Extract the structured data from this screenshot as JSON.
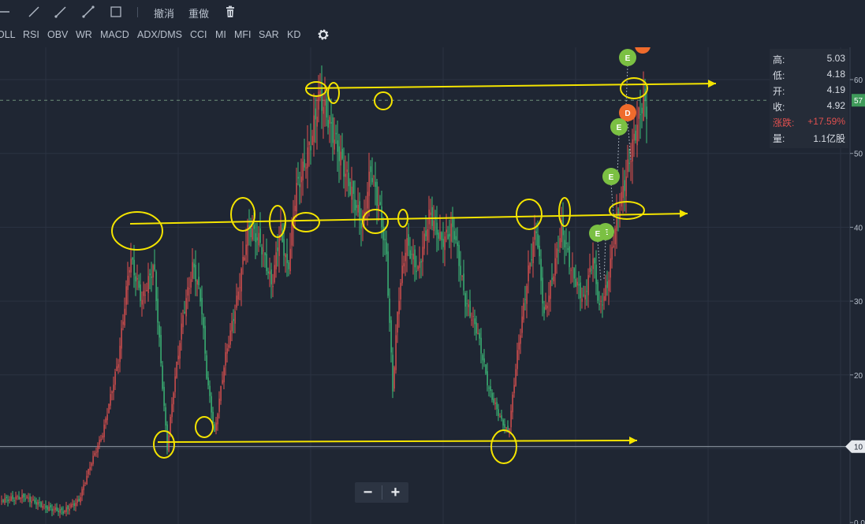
{
  "toolbar": {
    "undo_label": "撤消",
    "redo_label": "重做"
  },
  "indicators": [
    "OLL",
    "RSI",
    "OBV",
    "WR",
    "MACD",
    "ADX/DMS",
    "CCI",
    "MI",
    "MFI",
    "SAR",
    "KD"
  ],
  "info_panel": {
    "high_label": "高:",
    "high_value": "5.03",
    "low_label": "低:",
    "low_value": "4.18",
    "open_label": "开:",
    "open_value": "4.19",
    "close_label": "收:",
    "close_value": "4.92",
    "change_label": "涨跌:",
    "change_value": "+17.59%",
    "volume_label": "量:",
    "volume_value": "1.1亿股"
  },
  "axis": {
    "ticks": [
      "60",
      "50",
      "40",
      "30",
      "20",
      "10",
      "0.0"
    ],
    "current_price_tag": "57",
    "line_price_tag": "10"
  },
  "markers": [
    "E",
    "D",
    "E",
    "E",
    "E",
    "E"
  ],
  "colors": {
    "up": "#e0504f",
    "down": "#3dbf7a",
    "annotation": "#f4e400",
    "marker_e": "#7bc043",
    "marker_d": "#ef6b2c"
  },
  "zoom": {
    "minus": "−",
    "plus": "+"
  }
}
